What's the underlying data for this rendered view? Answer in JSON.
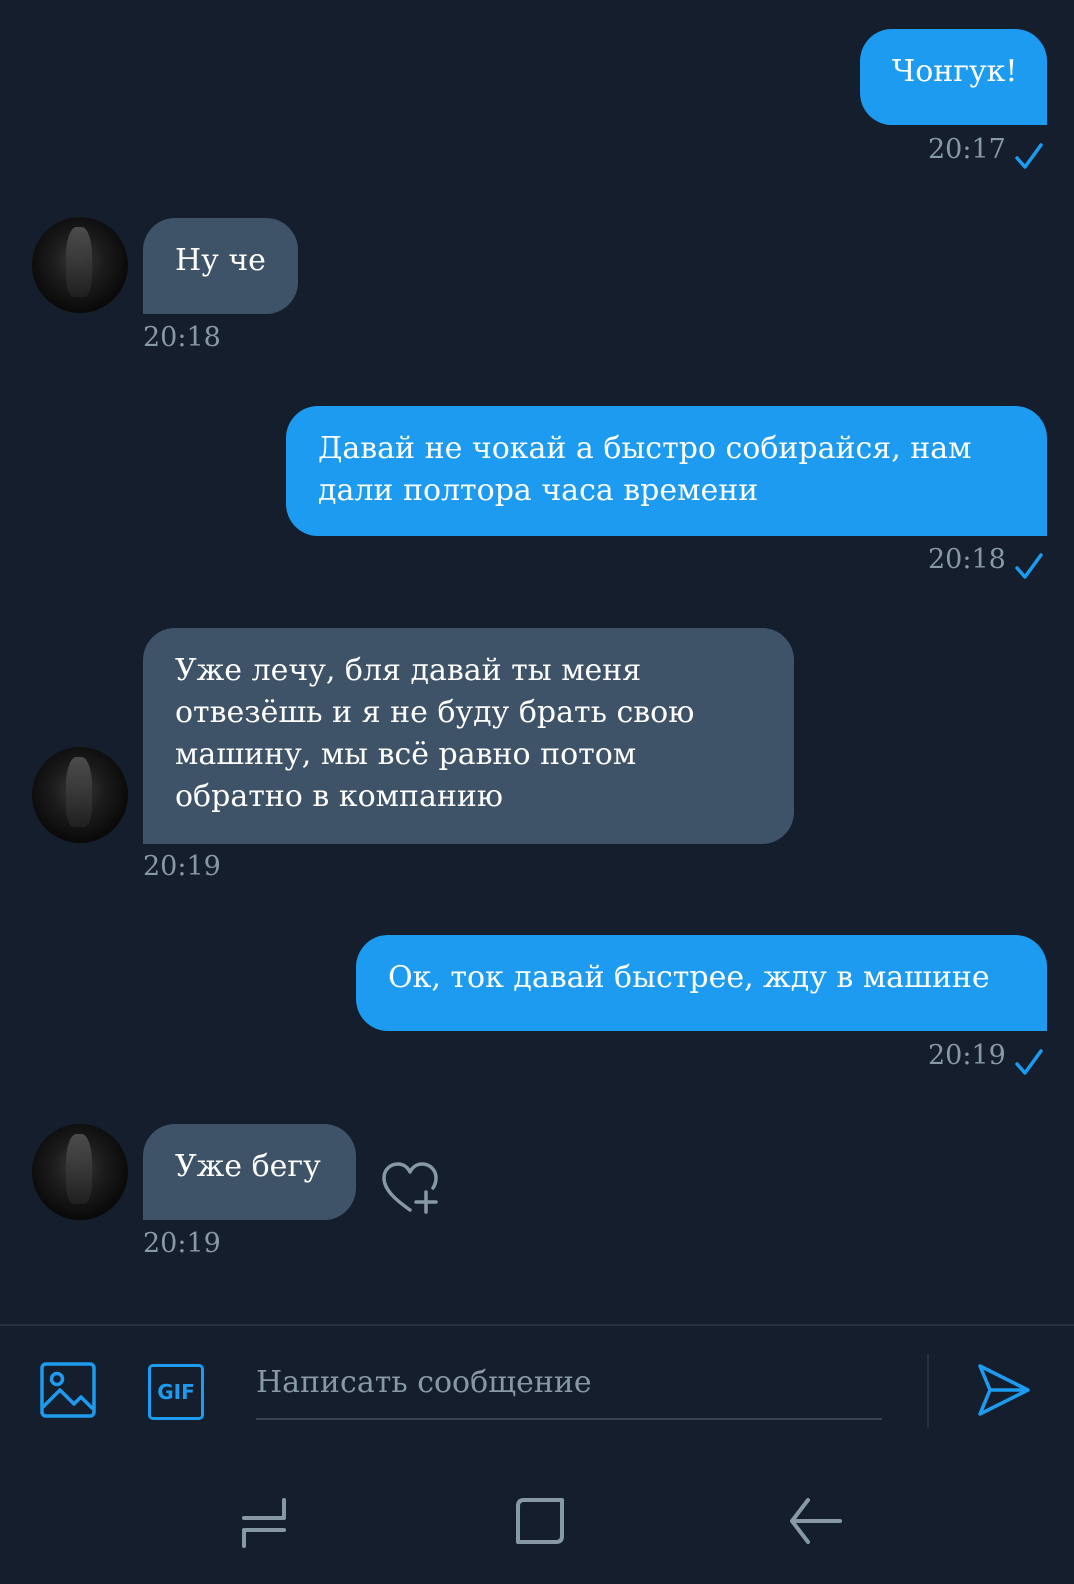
{
  "messages": [
    {
      "direction": "out",
      "text": "Чонгук!",
      "time": "20:17"
    },
    {
      "direction": "in",
      "text": "Ну че",
      "time": "20:18"
    },
    {
      "direction": "out",
      "text": "Давай не чокай а быстро собирайся, нам\nдали полтора часа времени",
      "time": "20:18"
    },
    {
      "direction": "in",
      "text": "Уже лечу, бля давай ты меня\nотвезёшь и я не буду брать свою\nмашину, мы всё равно потом\nобратно в компанию",
      "time": "20:19"
    },
    {
      "direction": "out",
      "text": "Ок, ток давай быстрее, жду в машине",
      "time": "20:19"
    },
    {
      "direction": "in",
      "text": "Уже бегу",
      "time": "20:19"
    }
  ],
  "composer": {
    "placeholder": "Написать сообщение",
    "gif_label": "GIF"
  },
  "icons": {
    "image": "image-icon",
    "gif": "gif-icon",
    "send": "send-icon",
    "read_check": "checkmark-icon",
    "like": "heart-plus-icon",
    "nav_recents": "recents-icon",
    "nav_home": "home-icon",
    "nav_back": "back-icon"
  },
  "colors": {
    "background": "#151e2c",
    "outgoing_bubble": "#1d9bf0",
    "incoming_bubble": "#3e5368",
    "accent": "#1d9bf0",
    "muted_text": "#8899a6"
  }
}
